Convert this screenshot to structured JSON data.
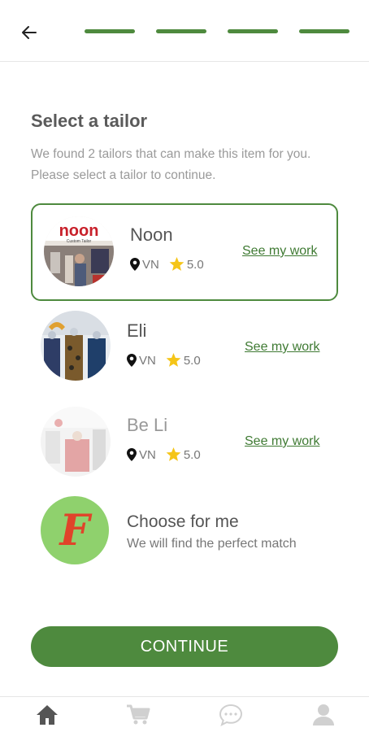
{
  "header": {
    "progress_steps": 4,
    "progress_completed": 4,
    "accent_color": "#4e8a3e"
  },
  "page": {
    "title": "Select a tailor",
    "subtitle": "We found 2 tailors that can make this item for you. Please select a tailor to continue."
  },
  "tailors": [
    {
      "name": "Noon",
      "location": "VN",
      "rating": "5.0",
      "link": "See my work",
      "selected": true
    },
    {
      "name": "Eli",
      "location": "VN",
      "rating": "5.0",
      "link": "See my work",
      "selected": false
    },
    {
      "name": "Be Li",
      "location": "VN",
      "rating": "5.0",
      "link": "See my work",
      "selected": false
    }
  ],
  "noon_logo": {
    "brand": "noon",
    "tagline": "Custom Tailor"
  },
  "choose": {
    "title": "Choose for me",
    "subtitle": "We will find the perfect match",
    "logo_letter": "F"
  },
  "continue_label": "CONTINUE",
  "nav": {
    "items": [
      "home-icon",
      "cart-icon",
      "chat-icon",
      "profile-icon"
    ],
    "active_color": "#555555",
    "inactive_color": "#d0d0d0"
  }
}
